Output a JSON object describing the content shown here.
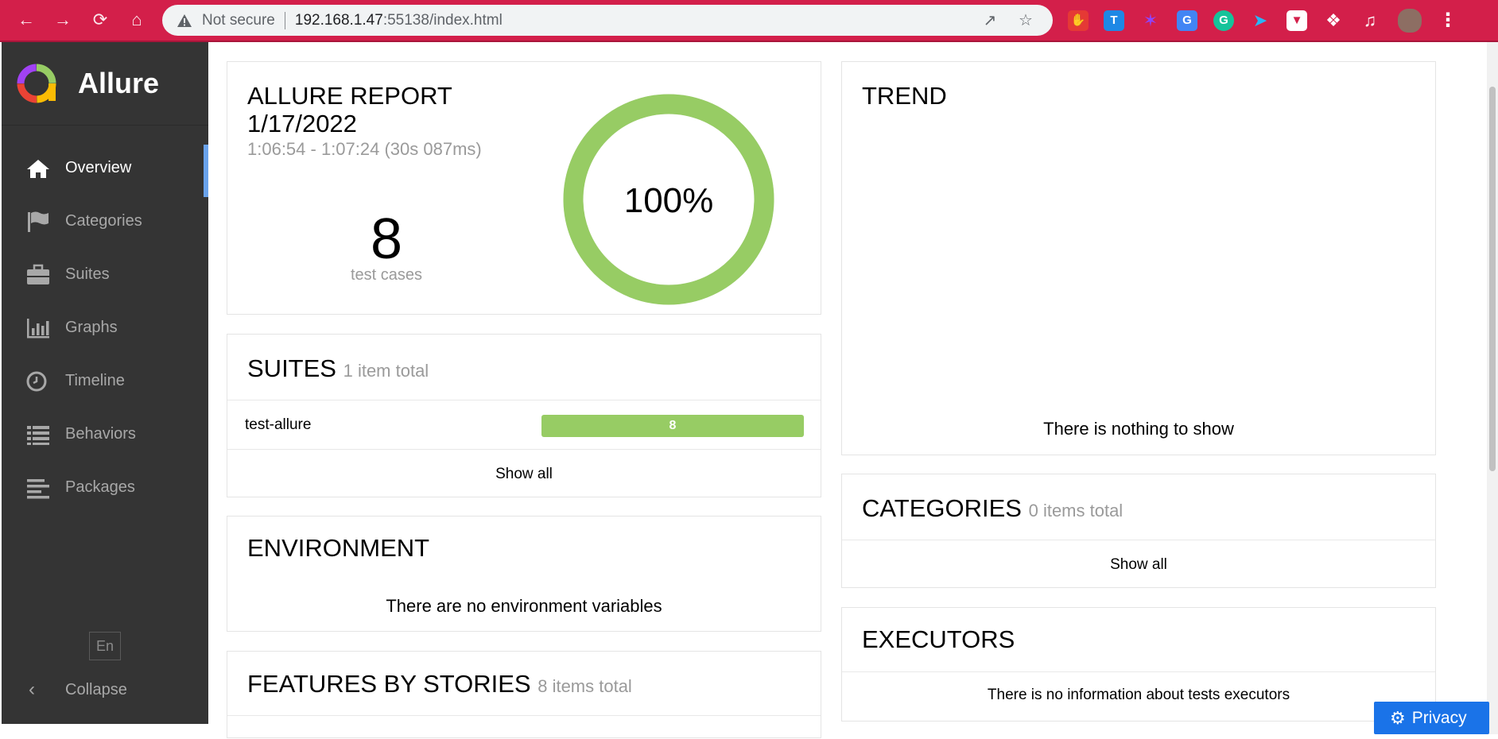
{
  "browser": {
    "security": "Not secure",
    "url_host": "192.168.1.47",
    "url_rest": ":55138/index.html"
  },
  "sidebar": {
    "brand": "Allure",
    "items": [
      {
        "label": "Overview",
        "icon": "home-icon"
      },
      {
        "label": "Categories",
        "icon": "flag-icon"
      },
      {
        "label": "Suites",
        "icon": "briefcase-icon"
      },
      {
        "label": "Graphs",
        "icon": "bar-chart-icon"
      },
      {
        "label": "Timeline",
        "icon": "clock-icon"
      },
      {
        "label": "Behaviors",
        "icon": "list-icon"
      },
      {
        "label": "Packages",
        "icon": "align-left-icon"
      }
    ],
    "active": "Overview",
    "language": "En",
    "collapse": "Collapse"
  },
  "summary": {
    "title": "ALLURE REPORT",
    "date": "1/17/2022",
    "time": "1:06:54 - 1:07:24 (30s 087ms)",
    "count": "8",
    "count_label": "test cases",
    "percent": "100%",
    "passed_fraction": 1.0
  },
  "suites": {
    "title": "SUITES",
    "subtitle": "1 item total",
    "items": [
      {
        "name": "test-allure",
        "count": "8"
      }
    ],
    "show_all": "Show all"
  },
  "environment": {
    "title": "ENVIRONMENT",
    "empty": "There are no environment variables"
  },
  "features": {
    "title": "FEATURES BY STORIES",
    "subtitle": "8 items total"
  },
  "trend": {
    "title": "TREND",
    "empty": "There is nothing to show"
  },
  "categories": {
    "title": "CATEGORIES",
    "subtitle": "0 items total",
    "show_all": "Show all"
  },
  "executors": {
    "title": "EXECUTORS",
    "empty": "There is no information about tests executors"
  },
  "privacy": {
    "label": "Privacy"
  },
  "colors": {
    "chrome": "#d31f4a",
    "sidebar": "#343434",
    "active_marker": "#6aa3ec",
    "passed": "#97cc64",
    "privacy": "#1a73e8"
  }
}
